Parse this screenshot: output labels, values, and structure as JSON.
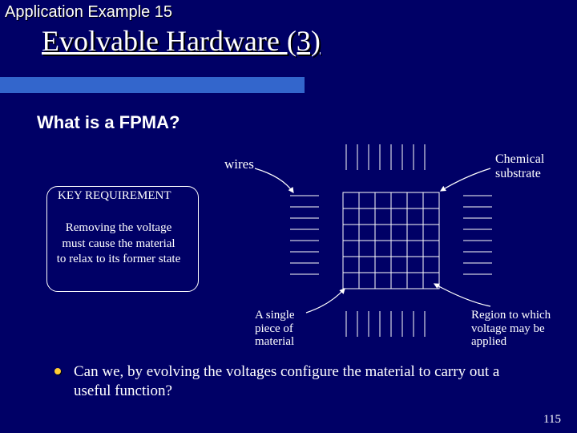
{
  "header": {
    "sup_title": "Application Example 15",
    "title": "Evolvable Hardware (3)"
  },
  "section_title": "What is a FPMA?",
  "labels": {
    "wires": "wires",
    "chemical_substrate": "Chemical substrate",
    "single_piece": "A single piece of material",
    "region_voltage": "Region to which voltage may be applied"
  },
  "key_box": {
    "heading": "KEY REQUIREMENT",
    "body": "Removing the voltage must cause the material to relax to its former state"
  },
  "bullet": "Can we, by evolving the voltages configure the material to carry out a useful function?",
  "page_number": "115",
  "colors": {
    "bg": "#000066",
    "bar": "#3366cc",
    "bullet_dot": "#ffcc33",
    "diagram_line": "#ffffff"
  },
  "diagram": {
    "grid": {
      "rows": 6,
      "cols": 6
    },
    "wire_groups": 4
  }
}
